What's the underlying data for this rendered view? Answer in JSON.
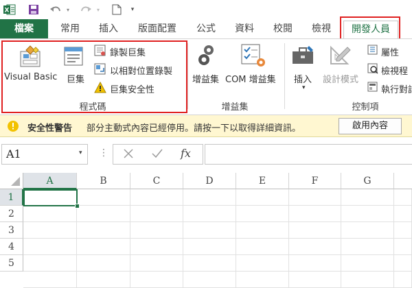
{
  "quick_access": {
    "icons": [
      "excel-icon",
      "save-icon",
      "undo-icon",
      "redo-icon",
      "new-document-icon",
      "customize-icon"
    ]
  },
  "tabs": [
    {
      "label": "檔案",
      "kind": "file"
    },
    {
      "label": "常用"
    },
    {
      "label": "插入"
    },
    {
      "label": "版面配置"
    },
    {
      "label": "公式"
    },
    {
      "label": "資料"
    },
    {
      "label": "校閱"
    },
    {
      "label": "檢視"
    },
    {
      "label": "開發人員",
      "kind": "active"
    }
  ],
  "ribbon": {
    "code_group": {
      "label": "程式碼",
      "visual_basic": "Visual Basic",
      "macros": "巨集",
      "record_macro": "錄製巨集",
      "relative_refs": "以相對位置錄製",
      "macro_security": "巨集安全性"
    },
    "addins_group": {
      "label": "增益集",
      "addins": "增益集",
      "com_addins": "COM 增益集"
    },
    "controls_group": {
      "label": "控制項",
      "insert": "插入",
      "design_mode": "設計模式",
      "properties": "屬性",
      "view_code": "檢視程",
      "run_dialog": "執行對話"
    }
  },
  "message_bar": {
    "title": "安全性警告",
    "text": "部分主動式內容已經停用。請按一下以取得詳細資訊。",
    "button": "啟用內容"
  },
  "formula_bar": {
    "name_box": "A1",
    "fx": "fx",
    "formula": ""
  },
  "grid": {
    "columns": [
      "A",
      "B",
      "C",
      "D",
      "E",
      "F",
      "G"
    ],
    "rows": [
      "1",
      "2",
      "3",
      "4",
      "5"
    ],
    "selected_cell": "A1"
  },
  "colors": {
    "accent": "#217346",
    "highlight": "#e02020",
    "message_bg": "#fff7d1"
  }
}
